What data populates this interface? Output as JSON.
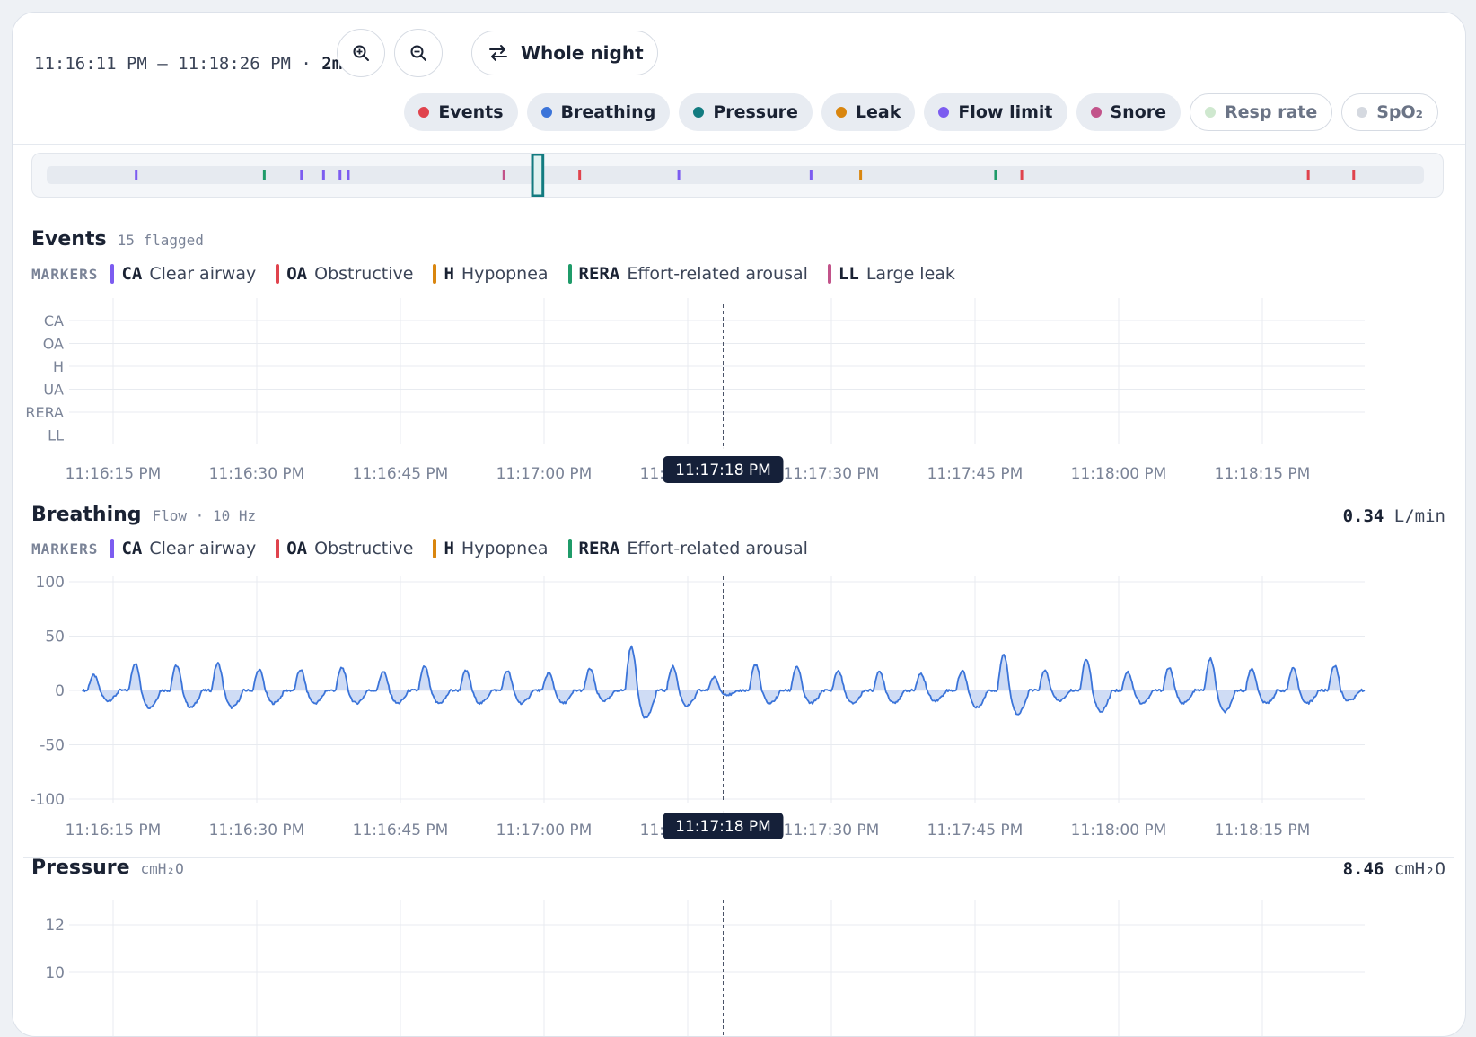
{
  "toolbar": {
    "range_label": "11:16:11 PM – 11:18:26 PM · ",
    "range_span": "2m",
    "zoom_in_icon": "zoom-in-icon",
    "zoom_out_icon": "zoom-out-icon",
    "whole_night_label": "Whole night",
    "whole_night_icon": "swap-arrows-icon"
  },
  "chips": [
    {
      "label": "Events",
      "color": "#e0434d",
      "active": true
    },
    {
      "label": "Breathing",
      "color": "#3b74d9",
      "active": true
    },
    {
      "label": "Pressure",
      "color": "#127b80",
      "active": true
    },
    {
      "label": "Leak",
      "color": "#d9860f",
      "active": true
    },
    {
      "label": "Flow limit",
      "color": "#7c5cf0",
      "active": true
    },
    {
      "label": "Snore",
      "color": "#c2538a",
      "active": true
    },
    {
      "label": "Resp rate",
      "color": "#cfe8cf",
      "active": false
    },
    {
      "label": "SpO₂",
      "color": "#d5d9e0",
      "active": false
    }
  ],
  "overview": {
    "ticks": [
      {
        "pos": 0.065,
        "color": "#7c5cf0"
      },
      {
        "pos": 0.158,
        "color": "#1f9b69"
      },
      {
        "pos": 0.185,
        "color": "#7c5cf0"
      },
      {
        "pos": 0.201,
        "color": "#7c5cf0"
      },
      {
        "pos": 0.213,
        "color": "#7c5cf0"
      },
      {
        "pos": 0.219,
        "color": "#7c5cf0"
      },
      {
        "pos": 0.332,
        "color": "#c2538a"
      },
      {
        "pos": 0.387,
        "color": "#e0434d"
      },
      {
        "pos": 0.459,
        "color": "#7c5cf0"
      },
      {
        "pos": 0.555,
        "color": "#7c5cf0"
      },
      {
        "pos": 0.591,
        "color": "#d9860f"
      },
      {
        "pos": 0.689,
        "color": "#1f9b69"
      },
      {
        "pos": 0.708,
        "color": "#e0434d"
      },
      {
        "pos": 0.916,
        "color": "#e0434d"
      },
      {
        "pos": 0.949,
        "color": "#e0434d"
      }
    ],
    "window_start": 0.354,
    "window_end": 0.359
  },
  "x_axis": {
    "ticks": [
      "11:16:15 PM",
      "11:16:30 PM",
      "11:16:45 PM",
      "11:17:00 PM",
      "11:17:15 PM",
      "11:17:30 PM",
      "11:17:45 PM",
      "11:18:00 PM",
      "11:18:15 PM"
    ],
    "start_seconds": 0,
    "cursor_label": "11:17:18 PM"
  },
  "events": {
    "title": "Events",
    "subtitle": "15 flagged",
    "markers_label": "MARKERS",
    "markers": [
      {
        "code": "CA",
        "name": "Clear airway",
        "color": "#7c5cf0"
      },
      {
        "code": "OA",
        "name": "Obstructive",
        "color": "#e0434d"
      },
      {
        "code": "H",
        "name": "Hypopnea",
        "color": "#d9860f"
      },
      {
        "code": "RERA",
        "name": "Effort-related arousal",
        "color": "#1f9b69"
      },
      {
        "code": "LL",
        "name": "Large leak",
        "color": "#c2538a"
      }
    ],
    "rows": [
      "CA",
      "OA",
      "H",
      "UA",
      "RERA",
      "LL"
    ]
  },
  "breathing": {
    "title": "Breathing",
    "subtitle": "Flow · 10 Hz",
    "readout_value": "0.34",
    "readout_unit": "L/min",
    "markers_label": "MARKERS",
    "markers": [
      {
        "code": "CA",
        "name": "Clear airway",
        "color": "#7c5cf0"
      },
      {
        "code": "OA",
        "name": "Obstructive",
        "color": "#e0434d"
      },
      {
        "code": "H",
        "name": "Hypopnea",
        "color": "#d9860f"
      },
      {
        "code": "RERA",
        "name": "Effort-related arousal",
        "color": "#1f9b69"
      }
    ],
    "y_ticks": [
      "100",
      "50",
      "0",
      "-50",
      "-100"
    ]
  },
  "pressure": {
    "title": "Pressure",
    "subtitle": "cmH₂O",
    "readout_value": "8.46",
    "readout_unit": "cmH₂O",
    "y_ticks": [
      "12",
      "10"
    ]
  },
  "chart_data": [
    {
      "type": "line",
      "title": "Breathing",
      "ylim": [
        -100,
        100
      ],
      "xlabel": "",
      "ylabel": "",
      "series": [
        {
          "peaks": [
            14,
            25,
            23,
            25,
            19,
            19,
            21,
            17,
            22,
            18,
            18,
            16,
            20,
            40,
            22,
            12,
            24,
            22,
            18,
            17,
            15,
            18,
            33,
            18,
            29,
            17,
            21,
            29,
            20,
            20,
            23
          ],
          "troughs": [
            -12,
            -20,
            -20,
            -20,
            -15,
            -15,
            -15,
            -15,
            -15,
            -15,
            -15,
            -15,
            -12,
            -32,
            -18,
            -5,
            -15,
            -15,
            -15,
            -14,
            -12,
            -20,
            -28,
            -12,
            -25,
            -15,
            -15,
            -25,
            -15,
            -15,
            -12
          ]
        }
      ],
      "grid": true
    }
  ]
}
